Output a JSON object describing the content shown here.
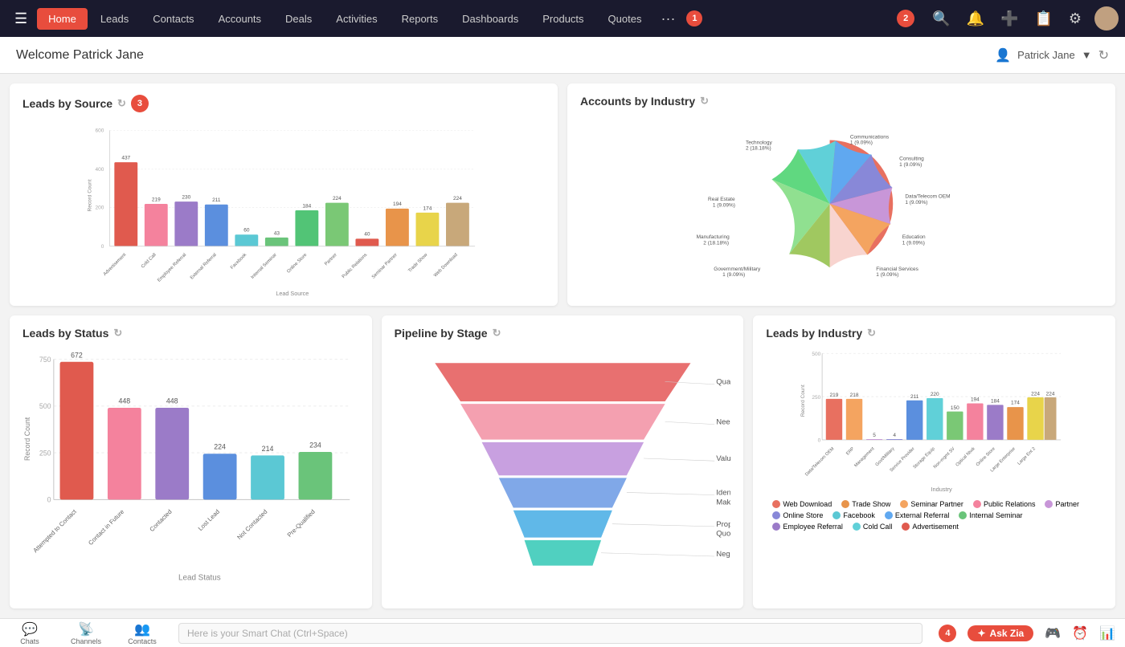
{
  "nav": {
    "items": [
      {
        "label": "Home",
        "active": true
      },
      {
        "label": "Leads"
      },
      {
        "label": "Contacts"
      },
      {
        "label": "Accounts"
      },
      {
        "label": "Deals"
      },
      {
        "label": "Activities"
      },
      {
        "label": "Reports"
      },
      {
        "label": "Dashboards"
      },
      {
        "label": "Products"
      },
      {
        "label": "Quotes"
      }
    ],
    "badge1": "1",
    "badge2": "2",
    "more": "···"
  },
  "header": {
    "welcome": "Welcome Patrick Jane",
    "user": "Patrick Jane"
  },
  "charts": {
    "leads_by_source": {
      "title": "Leads by Source",
      "y_label": "Record Count",
      "x_label": "Lead Source",
      "bars": [
        {
          "label": "Advertisement",
          "value": 437,
          "color": "#e05a4e"
        },
        {
          "label": "Cold Call",
          "value": 219,
          "color": "#f4829d"
        },
        {
          "label": "Employee Referral",
          "value": 230,
          "color": "#9b7bc8"
        },
        {
          "label": "External Referral",
          "value": 211,
          "color": "#5b8fde"
        },
        {
          "label": "Facebook",
          "value": 60,
          "color": "#5bc8d4"
        },
        {
          "label": "Internal Seminar",
          "value": 43,
          "color": "#6ac47a"
        },
        {
          "label": "Online Store",
          "value": 184,
          "color": "#52c476"
        },
        {
          "label": "Partner",
          "value": 224,
          "color": "#7ac875"
        },
        {
          "label": "Public Relations",
          "value": 40,
          "color": "#e05a4e"
        },
        {
          "label": "Seminar Partner",
          "value": 194,
          "color": "#e8944a"
        },
        {
          "label": "Trade Show",
          "value": 174,
          "color": "#e8d44a"
        },
        {
          "label": "Web Download",
          "value": 224,
          "color": "#c8a87a"
        }
      ],
      "y_ticks": [
        0,
        200,
        400,
        600
      ]
    },
    "accounts_by_industry": {
      "title": "Accounts by Industry",
      "slices": [
        {
          "label": "Technology\n2 (18.18%)",
          "pct": 18.18,
          "color": "#e87060"
        },
        {
          "label": "Communications\n1 (9.09%)",
          "pct": 9.09,
          "color": "#f4a460"
        },
        {
          "label": "Consulting\n1 (9.09%)",
          "pct": 9.09,
          "color": "#c896d8"
        },
        {
          "label": "Data/Telecom OEM\n1 (9.09%)",
          "pct": 9.09,
          "color": "#8888d8"
        },
        {
          "label": "Education\n1 (9.09%)",
          "pct": 9.09,
          "color": "#60a8f0"
        },
        {
          "label": "Financial Services\n1 (9.09%)",
          "pct": 9.09,
          "color": "#60d0d8"
        },
        {
          "label": "Government/Military\n1 (9.09%)",
          "pct": 9.09,
          "color": "#60d880"
        },
        {
          "label": "Manufacturing\n2 (18.18%)",
          "pct": 18.18,
          "color": "#90e090"
        },
        {
          "label": "Real Estate\n1 (9.09%)",
          "pct": 9.09,
          "color": "#a0c860"
        }
      ]
    },
    "leads_by_status": {
      "title": "Leads by Status",
      "y_label": "Record Count",
      "x_label": "Lead Status",
      "bars": [
        {
          "label": "Attempted to Contact",
          "value": 672,
          "color": "#e05a4e"
        },
        {
          "label": "Contact in Future",
          "value": 448,
          "color": "#f4829d"
        },
        {
          "label": "Contacted",
          "value": 448,
          "color": "#9b7bc8"
        },
        {
          "label": "Lost Lead",
          "value": 224,
          "color": "#5b8fde"
        },
        {
          "label": "Not Contacted",
          "value": 214,
          "color": "#5bc8d4"
        },
        {
          "label": "Pre-Qualified",
          "value": 234,
          "color": "#6ac47a"
        }
      ],
      "y_ticks": [
        0,
        250,
        500,
        750
      ]
    },
    "pipeline_by_stage": {
      "title": "Pipeline by Stage",
      "stages": [
        {
          "label": "Qualification",
          "color": "#e87070",
          "width_pct": 100
        },
        {
          "label": "Needs Analysis",
          "color": "#f4a0b0",
          "width_pct": 80
        },
        {
          "label": "Value Proposition",
          "color": "#c8a0e0",
          "width_pct": 62
        },
        {
          "label": "Identify Decision Makers",
          "color": "#80a8e8",
          "width_pct": 45
        },
        {
          "label": "Proposal/Price Quote",
          "color": "#60b8e8",
          "width_pct": 32
        },
        {
          "label": "Negotiation/Review",
          "color": "#50d0c0",
          "width_pct": 22
        }
      ]
    },
    "leads_by_industry": {
      "title": "Leads by Industry",
      "y_label": "Record Count",
      "x_label": "Industry",
      "bars": [
        {
          "label": "Data/Telecom OEM",
          "value": 219,
          "color": "#e87060"
        },
        {
          "label": "ERP",
          "value": 218,
          "color": "#f4a460"
        },
        {
          "label": "Management",
          "value": 5,
          "color": "#c896d8"
        },
        {
          "label": "Government/Military",
          "value": 4,
          "color": "#8888d8"
        },
        {
          "label": "Service Provider",
          "value": 211,
          "color": "#5b8fde"
        },
        {
          "label": "Storage Equipment",
          "value": 220,
          "color": "#60d0d8"
        },
        {
          "label": "Non-management SV",
          "value": 150,
          "color": "#7ac875"
        },
        {
          "label": "Optical Networking",
          "value": 194,
          "color": "#f4829d"
        },
        {
          "label": "Online Store",
          "value": 184,
          "color": "#9b7bc8"
        },
        {
          "label": "Large Enterprise",
          "value": 224,
          "color": "#e8944a"
        },
        {
          "label": "Large Enterprise 2",
          "value": 224,
          "color": "#e8d44a"
        }
      ],
      "y_ticks": [
        0,
        250,
        500
      ],
      "legend": [
        {
          "label": "Web Download",
          "color": "#e87060"
        },
        {
          "label": "Trade Show",
          "color": "#e8944a"
        },
        {
          "label": "Seminar Partner",
          "color": "#f4a460"
        },
        {
          "label": "Public Relations",
          "color": "#f4829d"
        },
        {
          "label": "Partner",
          "color": "#c896d8"
        },
        {
          "label": "Online Store",
          "color": "#8888d8"
        },
        {
          "label": "Facebook",
          "color": "#5bc8d4"
        },
        {
          "label": "External Referral",
          "color": "#60a8f0"
        },
        {
          "label": "Internal Seminar",
          "color": "#6ac47a"
        },
        {
          "label": "Employee Referral",
          "color": "#9b7bc8"
        },
        {
          "label": "Cold Call",
          "color": "#60d0d8"
        },
        {
          "label": "Advertisement",
          "color": "#e05a4e"
        }
      ]
    }
  },
  "statusbar": {
    "chat_placeholder": "Here is your Smart Chat (Ctrl+Space)",
    "items": [
      "Chats",
      "Channels",
      "Contacts"
    ],
    "zia_label": "Ask Zia",
    "badge4": "4"
  }
}
